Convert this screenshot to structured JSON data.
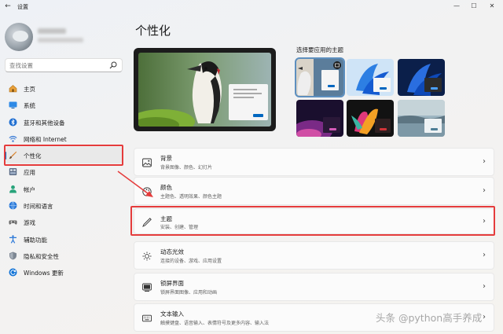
{
  "app": {
    "title": "设置"
  },
  "search": {
    "placeholder": "查找设置"
  },
  "sidebar": {
    "items": [
      {
        "label": "主页",
        "icon": "home-icon"
      },
      {
        "label": "系统",
        "icon": "display-icon"
      },
      {
        "label": "蓝牙和其他设备",
        "icon": "bluetooth-icon"
      },
      {
        "label": "网络和 Internet",
        "icon": "wifi-icon"
      },
      {
        "label": "个性化",
        "icon": "brush-icon"
      },
      {
        "label": "应用",
        "icon": "apps-icon"
      },
      {
        "label": "帐户",
        "icon": "person-icon"
      },
      {
        "label": "时间和语言",
        "icon": "globe-clock-icon"
      },
      {
        "label": "游戏",
        "icon": "gamepad-icon"
      },
      {
        "label": "辅助功能",
        "icon": "accessibility-icon"
      },
      {
        "label": "隐私和安全性",
        "icon": "shield-icon"
      },
      {
        "label": "Windows 更新",
        "icon": "update-icon"
      }
    ],
    "active_index": 4
  },
  "main": {
    "title": "个性化",
    "themes_label": "选择要应用的主题",
    "cards": [
      {
        "title": "背景",
        "subtitle": "背景图像、颜色、幻灯片",
        "icon": "image-icon"
      },
      {
        "title": "颜色",
        "subtitle": "主题色、透明效果、颜色主题",
        "icon": "palette-icon"
      },
      {
        "title": "主题",
        "subtitle": "安装、创建、管理",
        "icon": "pen-icon"
      },
      {
        "title": "动态光效",
        "subtitle": "连接的设备、游戏、应用设置",
        "icon": "sun-icon"
      },
      {
        "title": "锁屏界面",
        "subtitle": "锁屏界面图像、应用和动画",
        "icon": "lock-screen-icon"
      },
      {
        "title": "文本输入",
        "subtitle": "触摸键盘、语音输入、表情符号及更多内容、输入法",
        "icon": "keyboard-icon"
      }
    ]
  },
  "watermark": "头条 @python高手养成",
  "colors": {
    "accent": "#0067c0",
    "highlight": "#e53c3c"
  }
}
